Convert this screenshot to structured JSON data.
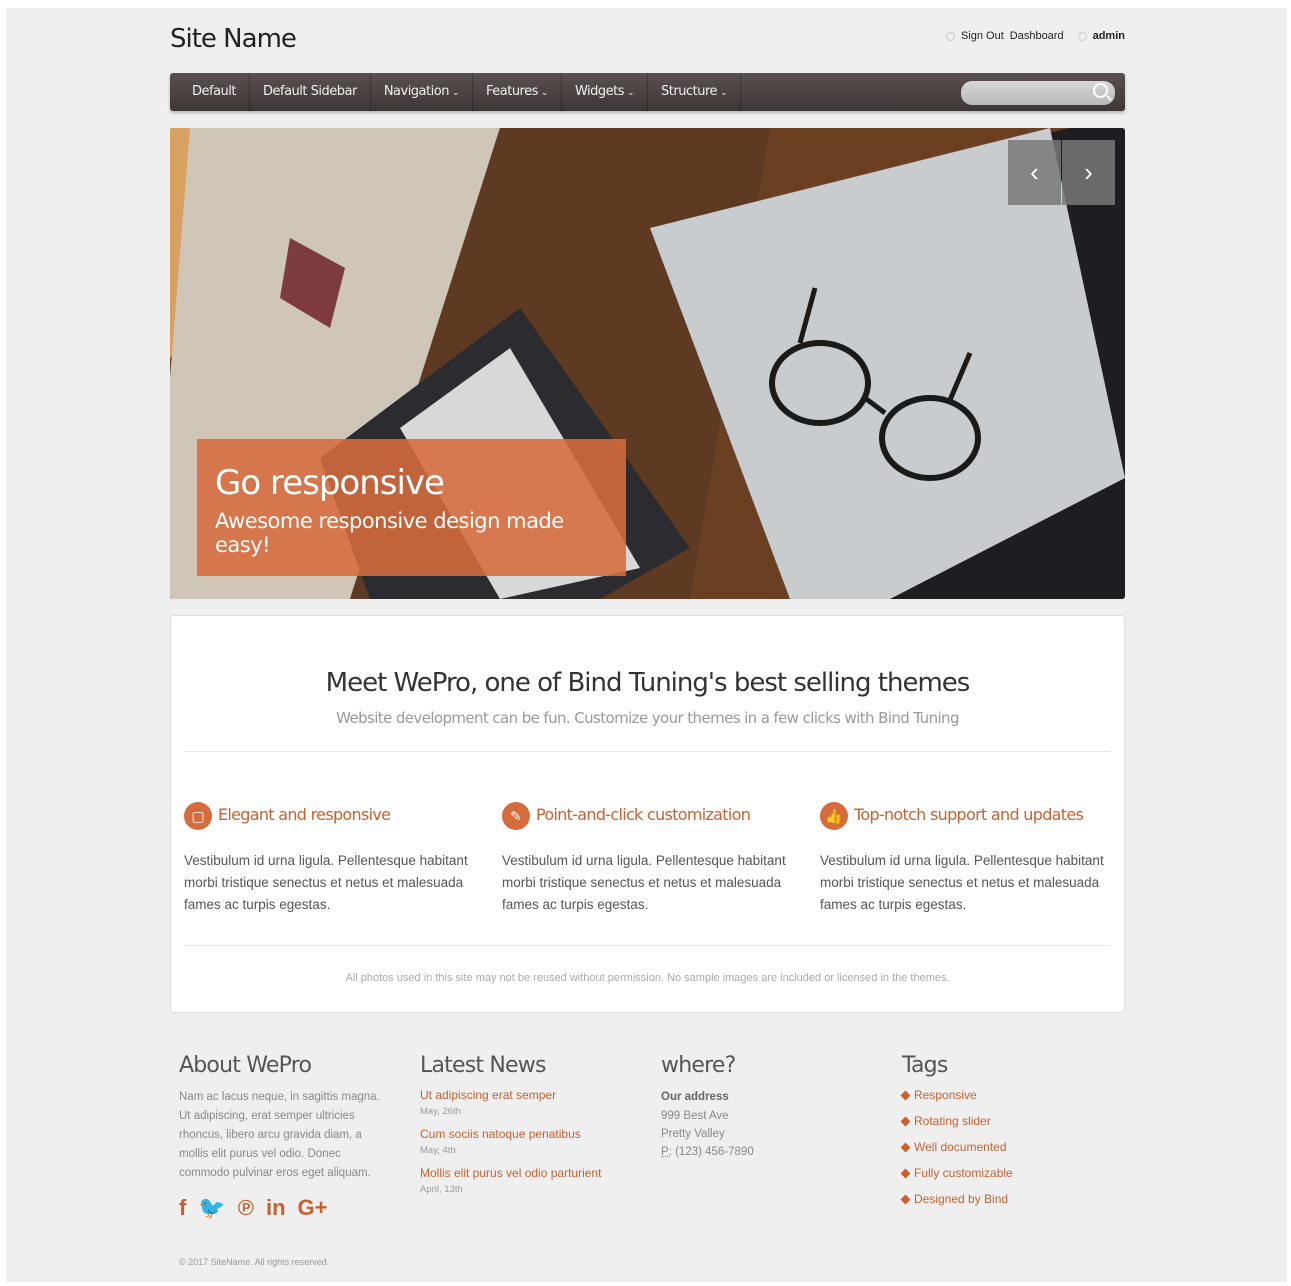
{
  "site": {
    "name": "Site Name"
  },
  "userbar": {
    "sign_out": "Sign Out",
    "dashboard": "Dashboard",
    "user": "admin"
  },
  "nav": {
    "items": [
      {
        "label": "Default",
        "dropdown": false
      },
      {
        "label": "Default Sidebar",
        "dropdown": false
      },
      {
        "label": "Navigation",
        "dropdown": true
      },
      {
        "label": "Features",
        "dropdown": true
      },
      {
        "label": "Widgets",
        "dropdown": true
      },
      {
        "label": "Structure",
        "dropdown": true
      }
    ],
    "chevron": "⌄",
    "search_placeholder": ""
  },
  "slider": {
    "title": "Go responsive",
    "subtitle": "Awesome responsive design made easy!",
    "prev": "‹",
    "next": "›"
  },
  "intro": {
    "title": "Meet WePro, one of Bind Tuning's best selling themes",
    "subtitle": "Website development can be fun. Customize your themes in a few clicks with Bind Tuning",
    "features": [
      {
        "icon": "tablet-icon",
        "glyph": "▢",
        "title": "Elegant and responsive",
        "text": "Vestibulum id urna ligula. Pellentesque habitant morbi tristique senectus et netus et malesuada fames ac turpis egestas."
      },
      {
        "icon": "magic-wand-icon",
        "glyph": "✎",
        "title": "Point-and-click customization",
        "text": "Vestibulum id urna ligula. Pellentesque habitant morbi tristique senectus et netus et malesuada fames ac turpis egestas."
      },
      {
        "icon": "thumbs-up-icon",
        "glyph": "👍",
        "title": "Top-notch support and updates",
        "text": "Vestibulum id urna ligula. Pellentesque habitant morbi tristique senectus et netus et malesuada fames ac turpis egestas."
      }
    ],
    "note": "All photos used in this site may not be reused without permission. No sample images are included or licensed in the themes."
  },
  "footer": {
    "about": {
      "heading": "About WePro",
      "text": "Nam ac lacus neque, in sagittis magna. Ut adipiscing, erat semper ultricies rhoncus, libero arcu gravida diam, a mollis elit purus vel odio. Donec commodo pulvinar eros eget aliquam.",
      "social": [
        "f",
        "🐦",
        "℗",
        "in",
        "G+"
      ]
    },
    "news": {
      "heading": "Latest News",
      "items": [
        {
          "title": "Ut adipiscing erat semper",
          "date": "May, 26th"
        },
        {
          "title": "Cum sociis natoque penatibus",
          "date": "May, 4th"
        },
        {
          "title": "Mollis elit purus vel odio parturient",
          "date": "April, 13th"
        }
      ]
    },
    "where": {
      "heading": "where?",
      "label": "Our address",
      "line1": "999 Best Ave",
      "line2": "Pretty Valley",
      "phone_prefix": "P:",
      "phone": " (123) 456-7890"
    },
    "tags": {
      "heading": "Tags",
      "items": [
        "Responsive",
        "Rotating slider",
        "Well documented",
        "Fully customizable",
        "Designed by Bind"
      ]
    },
    "copyright": "© 2017 SiteName. All rights reserved."
  },
  "colors": {
    "accent": "#d66b3c",
    "nav_bg": "#4a4242"
  }
}
